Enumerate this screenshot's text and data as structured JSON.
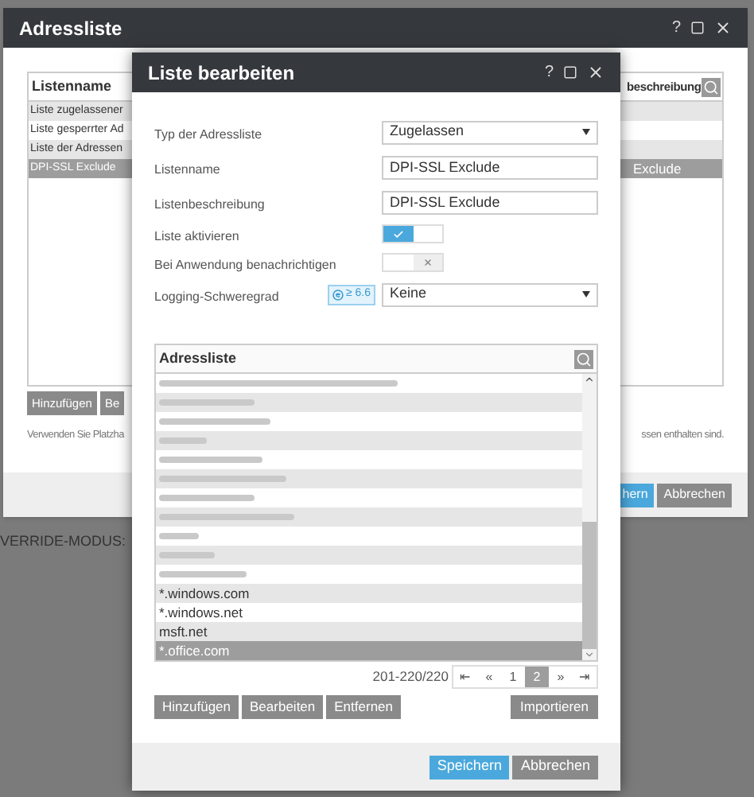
{
  "background": {
    "text": "VERRIDE-MODUS:"
  },
  "outer_window": {
    "title": "Adressliste",
    "help": "?",
    "table": {
      "column_1": "Listenname",
      "column_2": "beschreibung",
      "rows": [
        {
          "name": "Liste zugelassener",
          "selected": false
        },
        {
          "name": "Liste gesperrter Ad",
          "selected": false
        },
        {
          "name": "Liste der Adressen",
          "selected": false
        },
        {
          "name": "DPI-SSL Exclude",
          "description": "Exclude",
          "selected": true
        }
      ]
    },
    "buttons": [
      "Hinzufügen",
      "Be"
    ],
    "note_left": "Verwenden Sie Platzha",
    "note_right": "ssen enthalten sind.",
    "footer_buttons": [
      {
        "label": "hern",
        "kind": "primary"
      },
      {
        "label": "Abbrechen",
        "kind": "secondary"
      }
    ]
  },
  "inner_window": {
    "title": "Liste bearbeiten",
    "help": "?",
    "form": [
      {
        "kind": "select",
        "label": "Typ der Adressliste",
        "value": "Zugelassen"
      },
      {
        "kind": "text",
        "label": "Listenname",
        "value": "DPI-SSL Exclude"
      },
      {
        "kind": "text",
        "label": "Listenbeschreibung",
        "value": "DPI-SSL Exclude"
      },
      {
        "kind": "toggle",
        "label": "Liste aktivieren",
        "on": true
      },
      {
        "kind": "toggle",
        "label": "Bei Anwendung benachrichtigen",
        "on": false
      },
      {
        "kind": "select",
        "label": "Logging-Schweregrad",
        "badge": "≥ 6.6",
        "value": "Keine"
      }
    ],
    "address_list": {
      "title": "Adressliste",
      "rows": [
        {
          "kind": "redacted",
          "selected": false
        },
        {
          "kind": "redacted",
          "selected": false
        },
        {
          "kind": "redacted",
          "selected": false
        },
        {
          "kind": "redacted",
          "selected": false
        },
        {
          "kind": "redacted",
          "selected": false
        },
        {
          "kind": "redacted",
          "selected": false
        },
        {
          "kind": "redacted",
          "selected": false
        },
        {
          "kind": "redacted",
          "selected": false
        },
        {
          "kind": "redacted",
          "selected": false
        },
        {
          "kind": "redacted",
          "selected": false
        },
        {
          "kind": "redacted",
          "selected": false
        },
        {
          "kind": "text",
          "text": "*.windows.com",
          "selected": false
        },
        {
          "kind": "text",
          "text": "*.windows.net",
          "selected": false
        },
        {
          "kind": "text",
          "text": "msft.net",
          "selected": false
        },
        {
          "kind": "text",
          "text": "*.office.com",
          "selected": true
        }
      ],
      "range": "201-220/220",
      "pages": [
        {
          "label": "⇤",
          "selected": false
        },
        {
          "label": "«",
          "selected": false
        },
        {
          "label": "1",
          "selected": false
        },
        {
          "label": "2",
          "selected": true
        },
        {
          "label": "»",
          "selected": false
        },
        {
          "label": "⇥",
          "selected": false
        }
      ],
      "buttons": [
        "Hinzufügen",
        "Bearbeiten",
        "Entfernen"
      ],
      "import_button": "Importieren"
    },
    "footer_buttons": [
      {
        "label": "Speichern",
        "kind": "primary"
      },
      {
        "label": "Abbrechen",
        "kind": "secondary"
      }
    ]
  }
}
